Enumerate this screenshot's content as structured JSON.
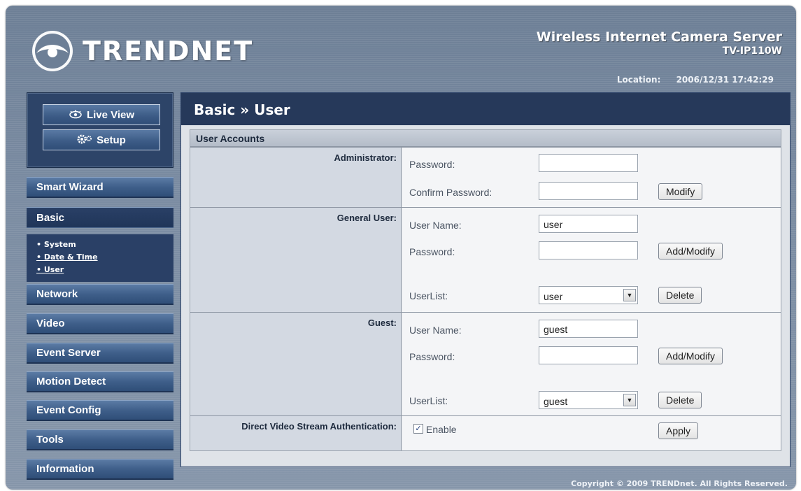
{
  "header": {
    "brand": "TRENDNET",
    "product_line1": "Wireless Internet Camera Server",
    "product_line2": "TV-IP110W",
    "location_label": "Location:",
    "location_value": "2006/12/31 17:42:29"
  },
  "sidebar": {
    "live_view": "Live View",
    "setup": "Setup",
    "items": [
      {
        "label": "Smart Wizard"
      },
      {
        "label": "Basic"
      },
      {
        "label": "Network"
      },
      {
        "label": "Video"
      },
      {
        "label": "Event Server"
      },
      {
        "label": "Motion Detect"
      },
      {
        "label": "Event Config"
      },
      {
        "label": "Tools"
      },
      {
        "label": "Information"
      }
    ],
    "basic_sub": [
      {
        "label": "• System"
      },
      {
        "label": "• Date & Time"
      },
      {
        "label": "• User"
      }
    ]
  },
  "page": {
    "title": "Basic » User",
    "section": "User Accounts"
  },
  "admin": {
    "label": "Administrator:",
    "password_label": "Password:",
    "confirm_label": "Confirm Password:",
    "password_value": "",
    "confirm_value": "",
    "modify": "Modify"
  },
  "general": {
    "label": "General User:",
    "username_label": "User Name:",
    "username_value": "user",
    "password_label": "Password:",
    "password_value": "",
    "add_modify": "Add/Modify",
    "userlist_label": "UserList:",
    "userlist_value": "user",
    "delete": "Delete"
  },
  "guest": {
    "label": "Guest:",
    "username_label": "User Name:",
    "username_value": "guest",
    "password_label": "Password:",
    "password_value": "",
    "add_modify": "Add/Modify",
    "userlist_label": "UserList:",
    "userlist_value": "guest",
    "delete": "Delete"
  },
  "dvsa": {
    "label": "Direct Video Stream Authentication:",
    "enable_label": "Enable",
    "enabled": true,
    "apply": "Apply"
  },
  "footer": {
    "copyright": "Copyright © 2009 TRENDnet. All Rights Reserved."
  }
}
